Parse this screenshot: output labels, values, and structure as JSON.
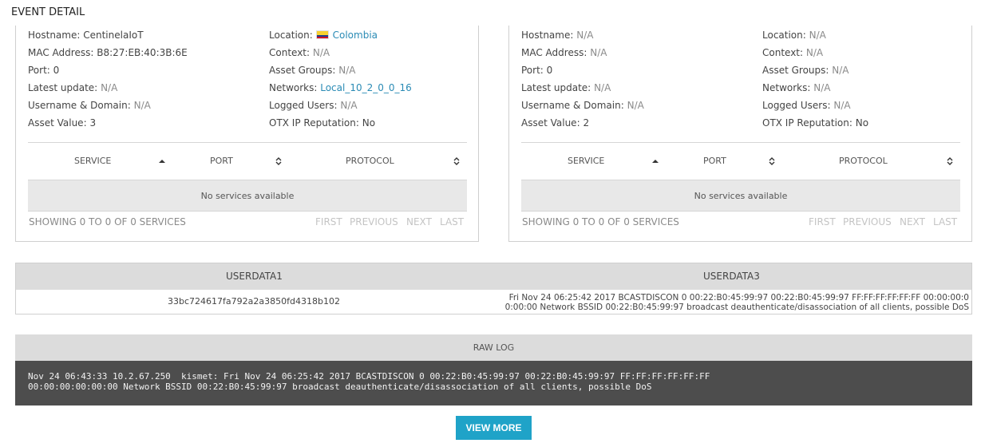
{
  "page": {
    "title": "EVENT DETAIL"
  },
  "labels": {
    "hostname": "Hostname:",
    "mac": "MAC Address:",
    "port": "Port:",
    "latest_update": "Latest update:",
    "username": "Username & Domain:",
    "asset_value": "Asset Value:",
    "location": "Location:",
    "context": "Context:",
    "asset_groups": "Asset Groups:",
    "networks": "Networks:",
    "logged_users": "Logged Users:",
    "otx": "OTX IP Reputation:"
  },
  "source": {
    "hostname": "CentinelaIoT",
    "mac": "B8:27:EB:40:3B:6E",
    "port": "0",
    "latest_update": "N/A",
    "username": "N/A",
    "asset_value": "3",
    "location": "Colombia",
    "location_flag": "colombia-flag-icon",
    "context": "N/A",
    "asset_groups": "N/A",
    "networks": "Local_10_2_0_0_16",
    "logged_users": "N/A",
    "otx": "No"
  },
  "destination": {
    "hostname": "N/A",
    "mac": "N/A",
    "port": "0",
    "latest_update": "N/A",
    "username": "N/A",
    "asset_value": "2",
    "location": "N/A",
    "context": "N/A",
    "asset_groups": "N/A",
    "networks": "N/A",
    "logged_users": "N/A",
    "otx": "No"
  },
  "services_table": {
    "columns": [
      "SERVICE",
      "PORT",
      "PROTOCOL"
    ],
    "empty_text": "No services available",
    "showing": "SHOWING 0 TO 0 OF 0 SERVICES",
    "pager": [
      "FIRST",
      "PREVIOUS",
      "NEXT",
      "LAST"
    ]
  },
  "userdata": {
    "headers": [
      "USERDATA1",
      "USERDATA3"
    ],
    "userdata1": "33bc724617fa792a2a3850fd4318b102",
    "userdata3_line1": "Fri Nov 24 06:25:42 2017 BCASTDISCON 0 00:22:B0:45:99:97 00:22:B0:45:99:97 FF:FF:FF:FF:FF:FF 00:00:00:0",
    "userdata3_line2": "0:00:00 Network BSSID 00:22:B0:45:99:97 broadcast deauthenticate/disassociation of all clients, possible DoS"
  },
  "raw_log": {
    "header": "RAW LOG",
    "line1": "Nov 24 06:43:33 10.2.67.250  kismet: Fri Nov 24 06:25:42 2017 BCASTDISCON 0 00:22:B0:45:99:97 00:22:B0:45:99:97 FF:FF:FF:FF:FF:FF",
    "line2": "00:00:00:00:00:00 Network BSSID 00:22:B0:45:99:97 broadcast deauthenticate/disassociation of all clients, possible DoS"
  },
  "actions": {
    "view_more": "VIEW MORE"
  },
  "colors": {
    "accent": "#1fa3c8",
    "link": "#2a8bb5",
    "raw_bg": "#4d4d4d",
    "header_bg": "#dcdcdc"
  }
}
